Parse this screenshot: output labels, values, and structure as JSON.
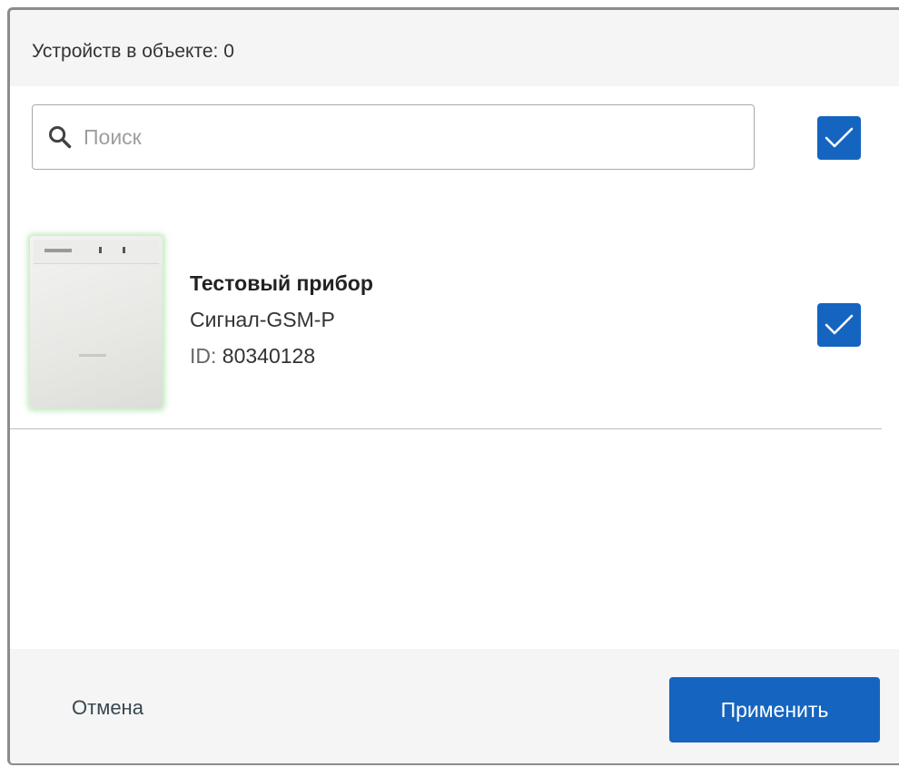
{
  "header": {
    "title": "Устройств в объекте: 0"
  },
  "search": {
    "placeholder": "Поиск",
    "value": "",
    "icon": "search-icon"
  },
  "select_all": {
    "checked": true
  },
  "devices": [
    {
      "name": "Тестовый прибор",
      "model": "Сигнал-GSM-P",
      "id_label": "ID:",
      "id_value": "80340128",
      "checked": true
    }
  ],
  "footer": {
    "cancel_label": "Отмена",
    "apply_label": "Применить"
  },
  "colors": {
    "accent": "#1565c0",
    "header_bg": "#f5f5f5",
    "text": "#333333"
  }
}
